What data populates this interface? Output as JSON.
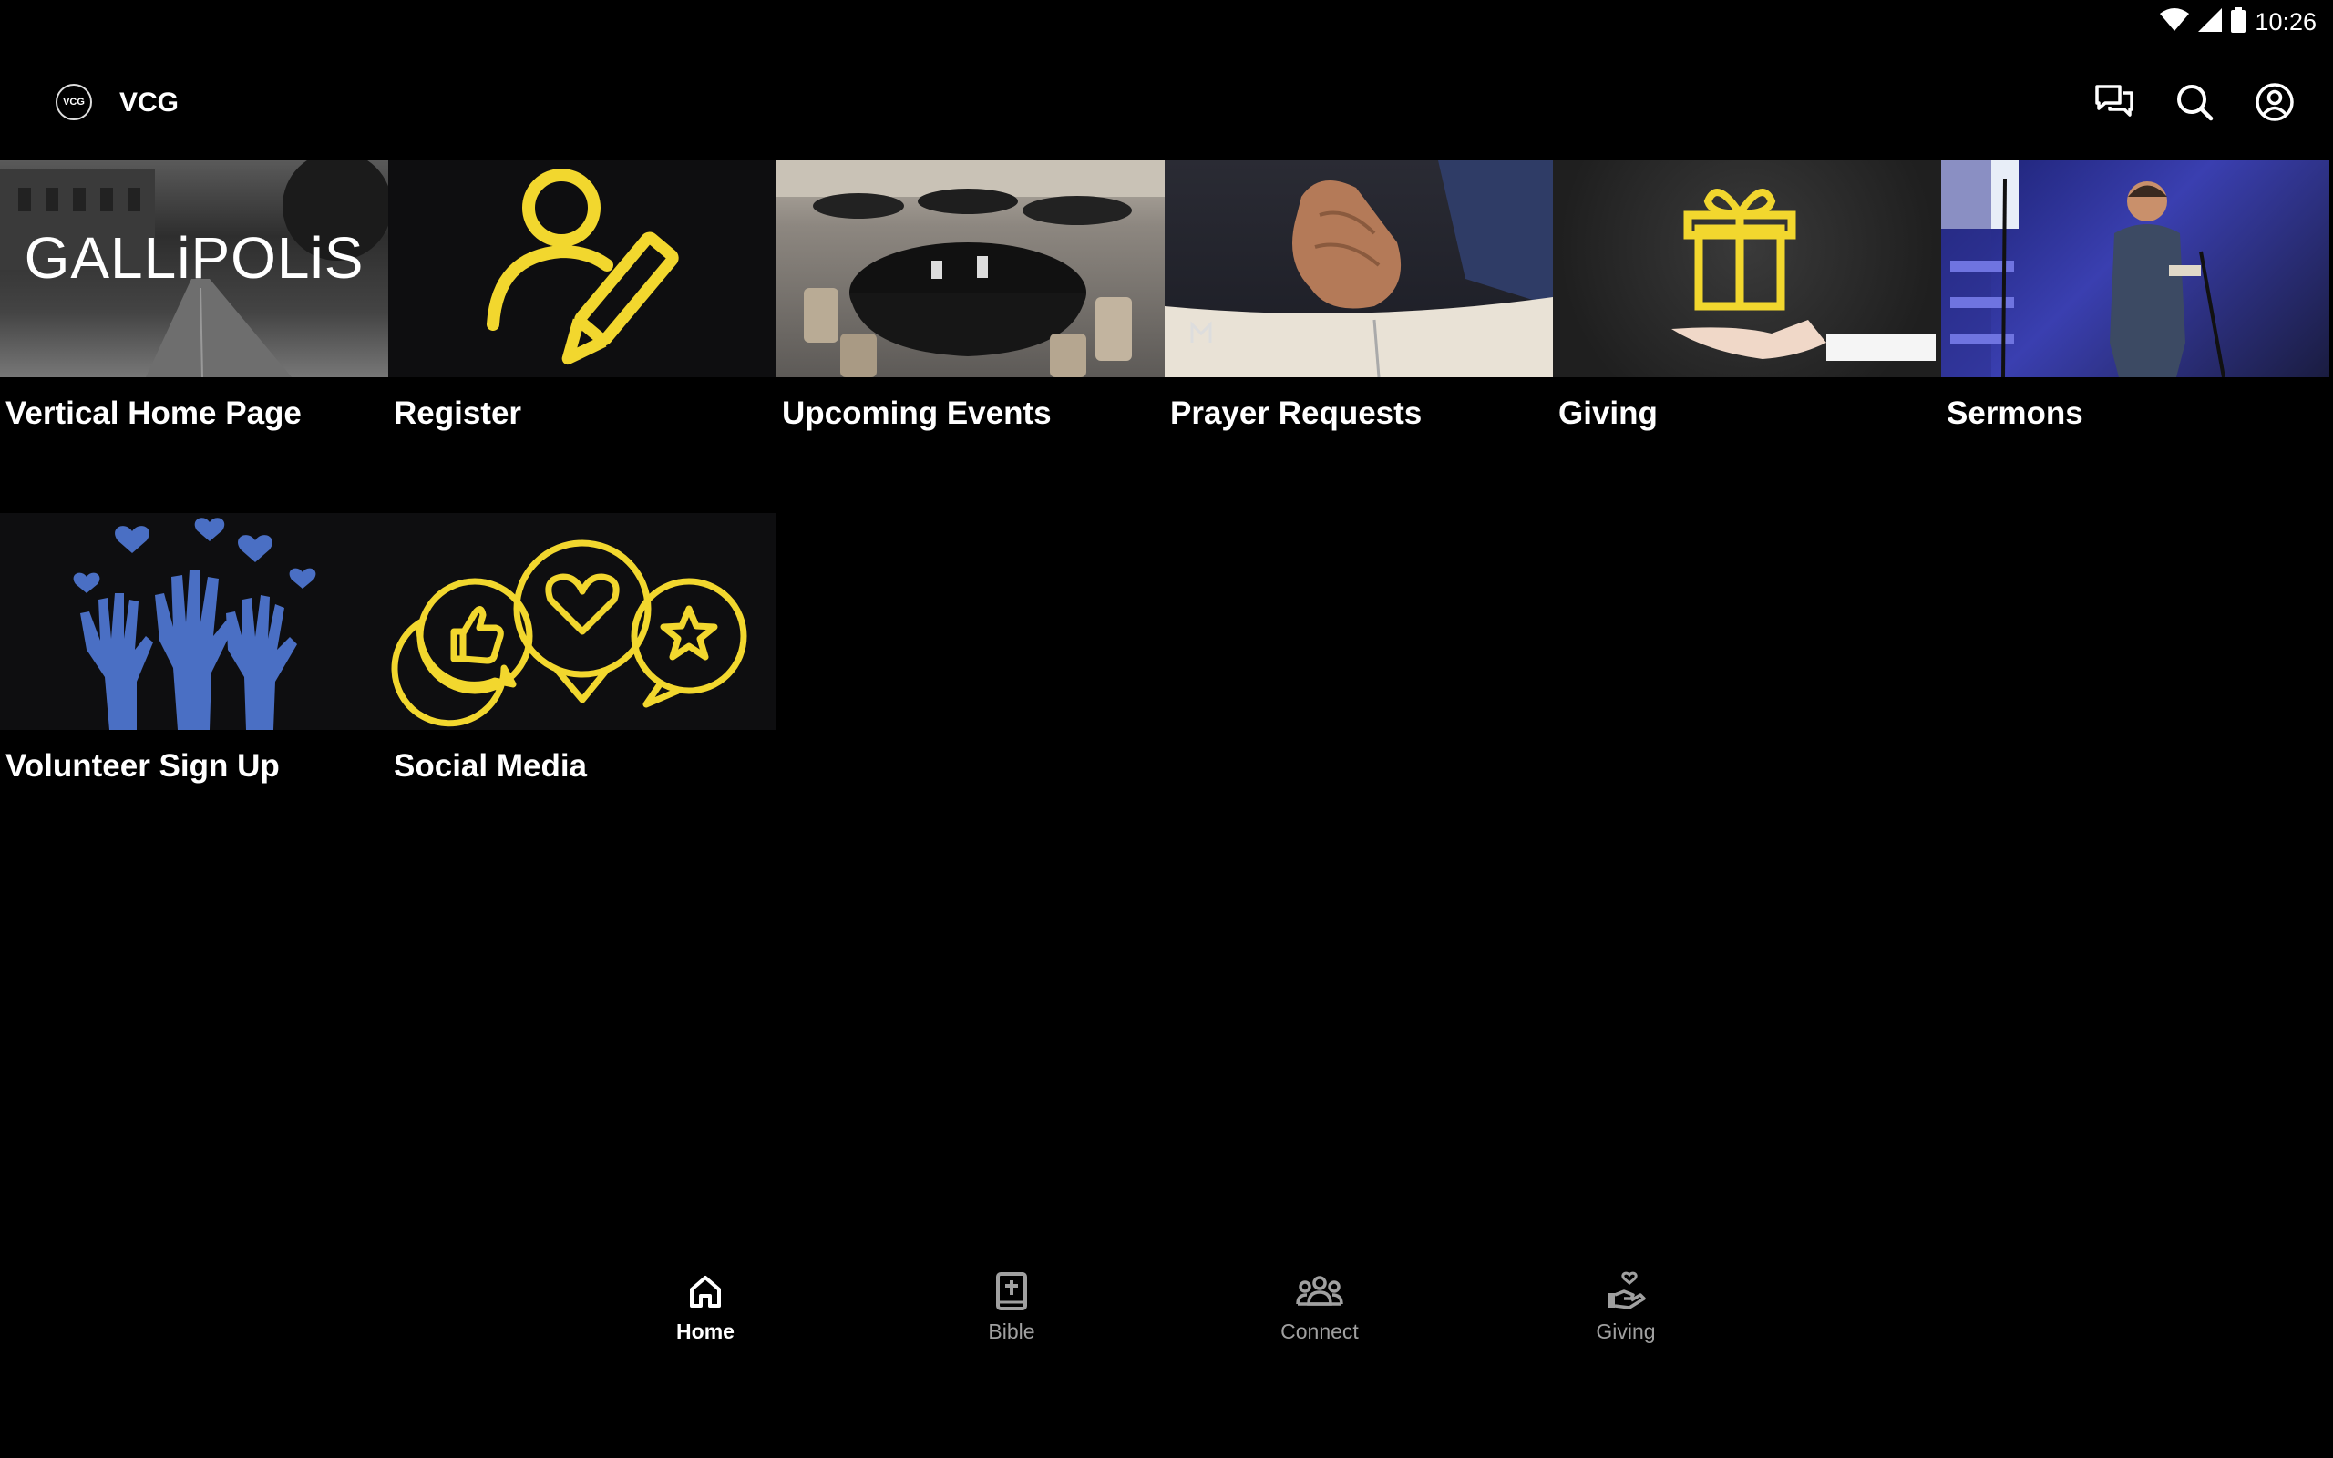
{
  "status": {
    "time": "10:26",
    "icons": [
      "wifi-icon",
      "signal-icon",
      "battery-icon"
    ]
  },
  "appbar": {
    "logo_text": "VCG",
    "title": "VCG",
    "actions": [
      "chat-icon",
      "search-icon",
      "account-icon"
    ]
  },
  "tiles": [
    {
      "label": "Vertical Home Page",
      "thumb_text": "GALLiPOLiS"
    },
    {
      "label": "Register"
    },
    {
      "label": "Upcoming Events"
    },
    {
      "label": "Prayer Requests"
    },
    {
      "label": "Giving"
    },
    {
      "label": "Sermons"
    },
    {
      "label": "Volunteer Sign Up"
    },
    {
      "label": "Social Media"
    }
  ],
  "nav": {
    "items": [
      {
        "label": "Home",
        "icon": "home-icon",
        "active": true
      },
      {
        "label": "Bible",
        "icon": "bible-icon",
        "active": false
      },
      {
        "label": "Connect",
        "icon": "people-icon",
        "active": false
      },
      {
        "label": "Giving",
        "icon": "giving-hand-icon",
        "active": false
      }
    ]
  },
  "colors": {
    "background": "#000000",
    "accent_yellow": "#f2d72e",
    "accent_blue": "#4a6fc4",
    "inactive": "#a0a0a0"
  }
}
